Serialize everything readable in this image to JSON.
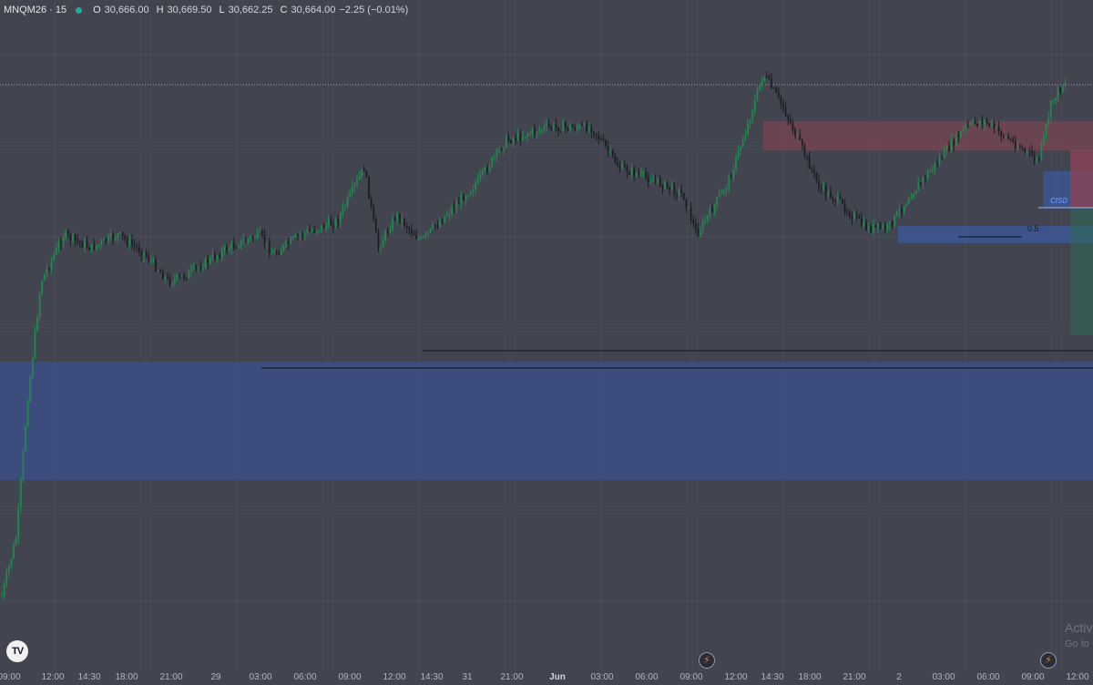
{
  "header": {
    "symbol": "MNQM26 · 15",
    "status_color": "#22ab94",
    "ohlc": [
      {
        "key": "O",
        "value": "30,666.00"
      },
      {
        "key": "H",
        "value": "30,669.50"
      },
      {
        "key": "L",
        "value": "30,662.25"
      },
      {
        "key": "C",
        "value": "30,664.00"
      }
    ],
    "change": "−2.25 (−0.01%)"
  },
  "colors": {
    "background": "#424450",
    "candle_up": "#1f8a4c",
    "candle_down": "#1c1c22",
    "demand_zone": "#3b4f87",
    "supply_zone": "#7a4452",
    "cisd": "#5b8ff9"
  },
  "annotations": {
    "cisd_label": "CISD",
    "fib_label": "0.5"
  },
  "icons": {
    "logo": "tradingview-logo",
    "event": "lightning-event-icon"
  },
  "watermark": {
    "line1": "Activ",
    "line2": "Go to"
  },
  "xaxis": {
    "labels": [
      "09:00",
      "12:00",
      "14:30",
      "18:00",
      "21:00",
      "29",
      "03:00",
      "06:00",
      "09:00",
      "12:00",
      "14:30",
      "31",
      "21:00",
      "Jun",
      "03:00",
      "06:00",
      "09:00",
      "12:00",
      "14:30",
      "18:00",
      "21:00",
      "2",
      "03:00",
      "06:00",
      "09:00",
      "12:00"
    ]
  },
  "chart_data": {
    "type": "candlestick",
    "symbol": "MNQM26",
    "interval": "15",
    "last": {
      "open": 30666.0,
      "high": 30669.5,
      "low": 30662.25,
      "close": 30664.0
    },
    "x_tick_labels": [
      "09:00",
      "12:00",
      "14:30",
      "18:00",
      "21:00",
      "29",
      "03:00",
      "06:00",
      "09:00",
      "12:00",
      "14:30",
      "31",
      "21:00",
      "Jun",
      "03:00",
      "06:00",
      "09:00",
      "12:00",
      "14:30",
      "18:00",
      "21:00",
      "2",
      "03:00",
      "06:00",
      "09:00",
      "12:00"
    ],
    "price_path": [
      [
        0,
        0.9
      ],
      [
        18,
        0.8
      ],
      [
        30,
        0.6
      ],
      [
        45,
        0.42
      ],
      [
        70,
        0.35
      ],
      [
        100,
        0.37
      ],
      [
        130,
        0.35
      ],
      [
        160,
        0.38
      ],
      [
        185,
        0.42
      ],
      [
        205,
        0.41
      ],
      [
        250,
        0.37
      ],
      [
        285,
        0.35
      ],
      [
        300,
        0.38
      ],
      [
        330,
        0.35
      ],
      [
        370,
        0.33
      ],
      [
        400,
        0.25
      ],
      [
        415,
        0.37
      ],
      [
        435,
        0.32
      ],
      [
        462,
        0.36
      ],
      [
        490,
        0.32
      ],
      [
        525,
        0.27
      ],
      [
        555,
        0.21
      ],
      [
        600,
        0.19
      ],
      [
        650,
        0.19
      ],
      [
        680,
        0.25
      ],
      [
        720,
        0.27
      ],
      [
        750,
        0.29
      ],
      [
        765,
        0.35
      ],
      [
        800,
        0.27
      ],
      [
        820,
        0.19
      ],
      [
        838,
        0.11
      ],
      [
        860,
        0.16
      ],
      [
        880,
        0.22
      ],
      [
        900,
        0.28
      ],
      [
        920,
        0.3
      ],
      [
        950,
        0.34
      ],
      [
        975,
        0.34
      ],
      [
        1000,
        0.29
      ],
      [
        1030,
        0.24
      ],
      [
        1060,
        0.19
      ],
      [
        1080,
        0.18
      ],
      [
        1100,
        0.2
      ],
      [
        1140,
        0.24
      ],
      [
        1155,
        0.15
      ],
      [
        1170,
        0.12
      ]
    ],
    "zones": [
      {
        "kind": "demand"
      },
      {
        "kind": "supply"
      },
      {
        "kind": "fvg"
      }
    ],
    "levels": [
      "equal-lows",
      "equal-lows",
      "current-price"
    ]
  }
}
